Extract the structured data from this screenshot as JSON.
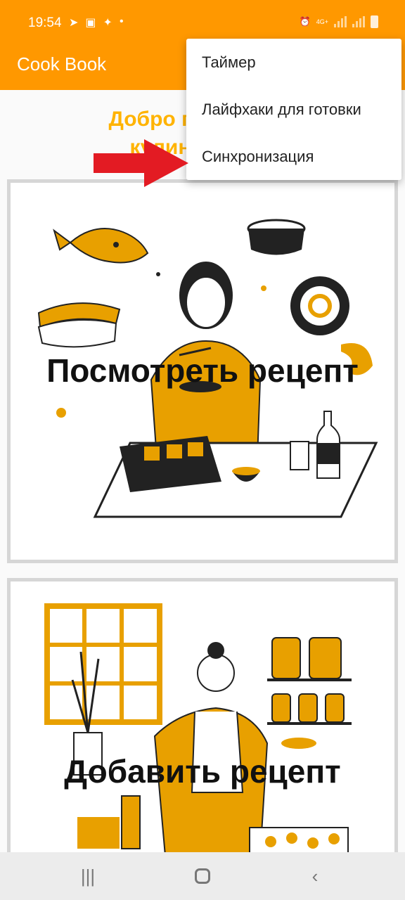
{
  "status_bar": {
    "time": "19:54",
    "network": "4G+",
    "icons": [
      "telegram-icon",
      "gallery-icon",
      "twitter-icon",
      "dot-icon",
      "alarm-icon",
      "signal-icon",
      "battery-icon"
    ]
  },
  "app_bar": {
    "title": "Cook Book"
  },
  "welcome": {
    "line1": "Добро пожал",
    "line2": "кулин"
  },
  "cards": {
    "view_recipe": "Посмотреть рецепт",
    "add_recipe": "Добавить рецепт"
  },
  "overflow_menu": {
    "items": [
      {
        "label": "Таймер"
      },
      {
        "label": "Лайфхаки для готовки"
      },
      {
        "label": "Синхронизация"
      }
    ]
  },
  "colors": {
    "accent": "#ff9800",
    "accent_text": "#ffb300",
    "illustration": "#e8a000",
    "arrow": "#e31b23"
  },
  "nav_bar": {
    "icons": [
      "recents-icon",
      "home-icon",
      "back-icon"
    ]
  }
}
